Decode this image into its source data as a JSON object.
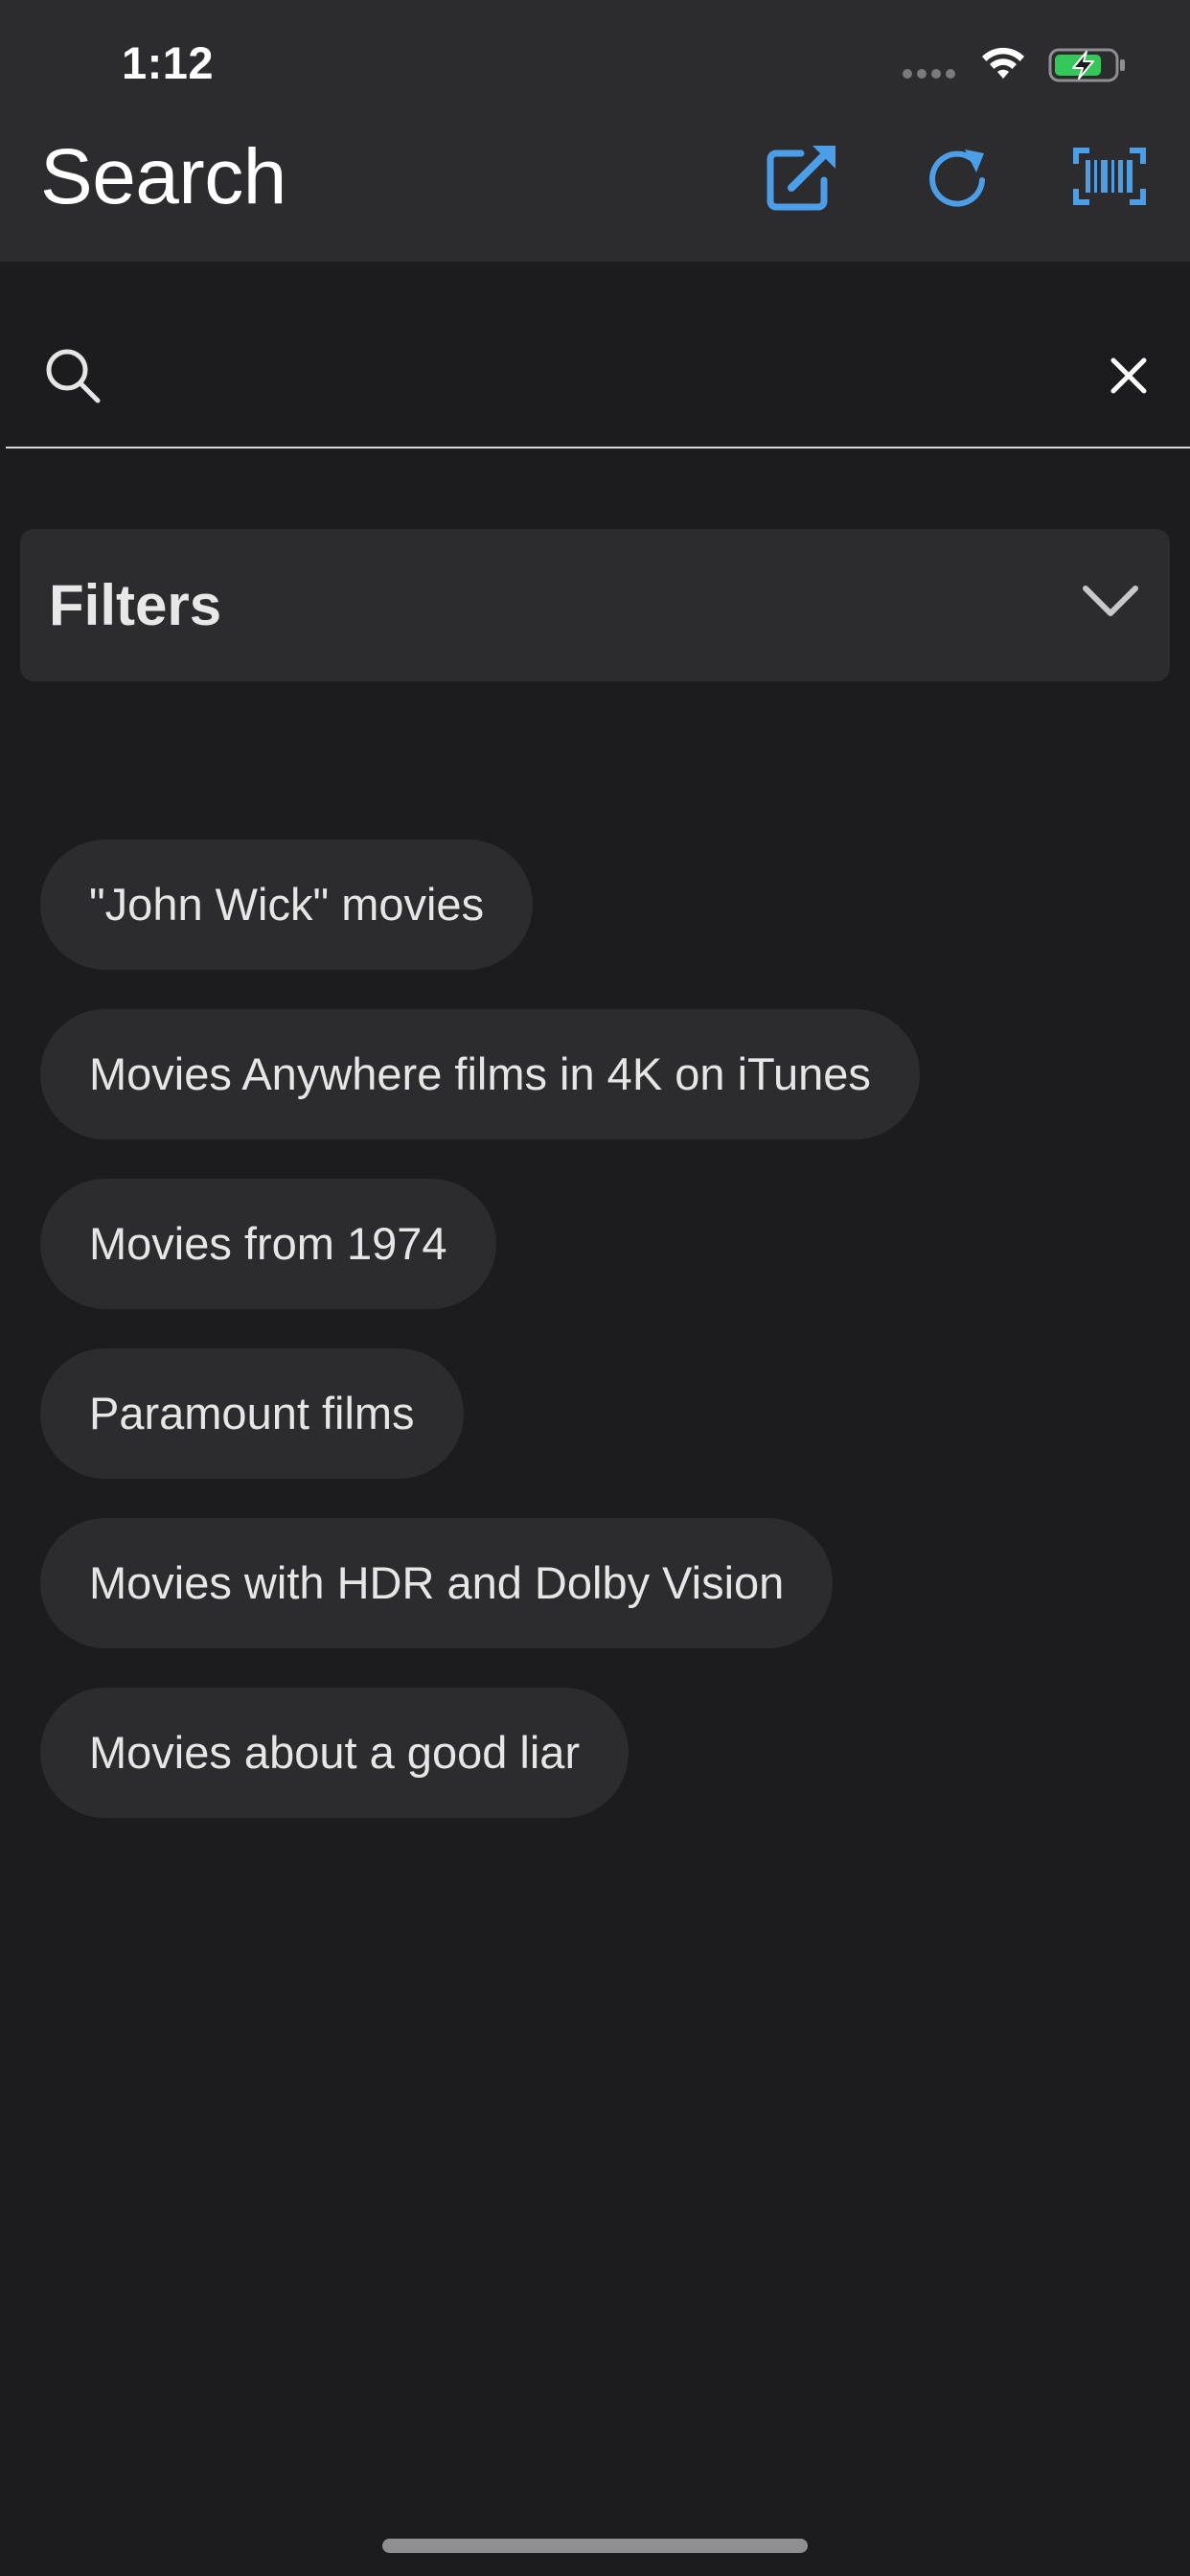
{
  "status_bar": {
    "time": "1:12"
  },
  "nav": {
    "title": "Search",
    "actions": [
      {
        "icon": "share-external-icon"
      },
      {
        "icon": "refresh-icon"
      },
      {
        "icon": "barcode-scan-icon"
      }
    ],
    "accent_color": "#4a9fe8"
  },
  "search": {
    "value": "",
    "placeholder": ""
  },
  "filters": {
    "label": "Filters",
    "icon": "chevron-down-icon"
  },
  "suggestions": [
    "\"John Wick\" movies",
    "Movies Anywhere films in 4K on iTunes",
    "Movies from 1974",
    "Paramount films",
    "Movies with HDR and Dolby Vision",
    "Movies about a good liar"
  ],
  "colors": {
    "background": "#1c1c1e",
    "surface": "#2c2c2e",
    "battery_fill": "#34c759"
  }
}
